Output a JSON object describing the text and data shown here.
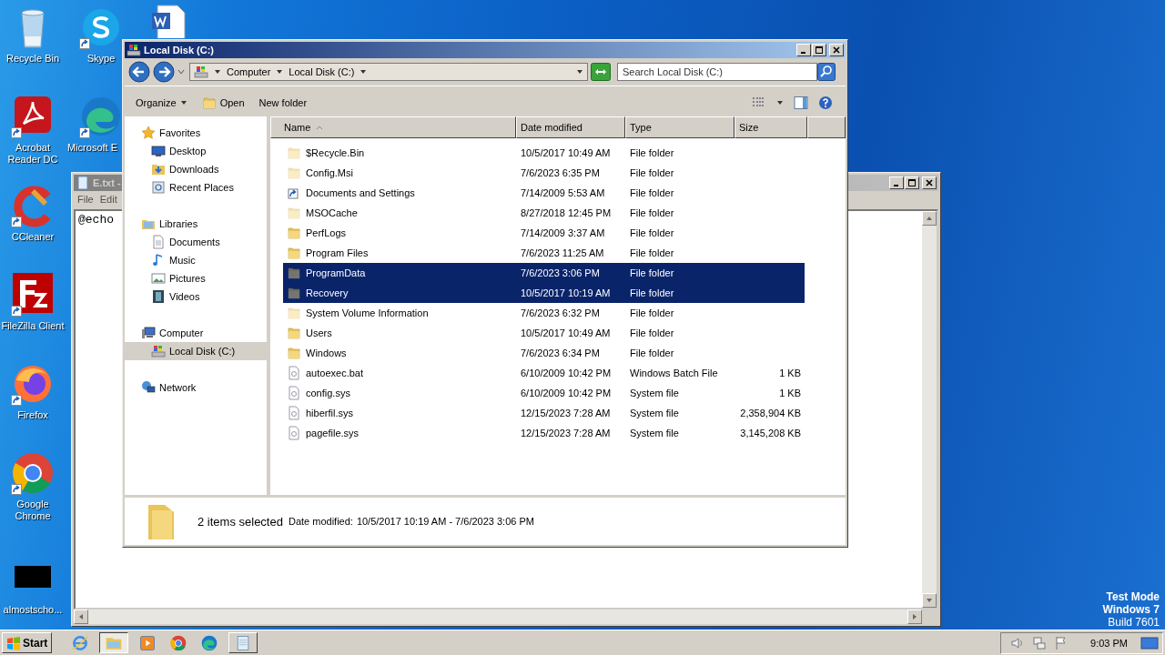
{
  "desktop_icons": [
    {
      "label": "Recycle Bin",
      "kind": "bin",
      "shortcut": false
    },
    {
      "label": "Acrobat Reader DC",
      "kind": "acrobat",
      "shortcut": true
    },
    {
      "label": "CCleaner",
      "kind": "ccleaner",
      "shortcut": true
    },
    {
      "label": "FileZilla Client",
      "kind": "filezilla",
      "shortcut": true
    },
    {
      "label": "Firefox",
      "kind": "firefox",
      "shortcut": true
    },
    {
      "label": "Google Chrome",
      "kind": "chrome",
      "shortcut": true
    },
    {
      "label": "almostscho...",
      "kind": "blank",
      "shortcut": false
    },
    {
      "label": "Skype",
      "kind": "skype",
      "shortcut": true
    },
    {
      "label": "Microsoft E",
      "kind": "edge",
      "shortcut": true
    },
    {
      "kind": "word",
      "shortcut": false
    }
  ],
  "notepad": {
    "title": "E.txt -",
    "menu": [
      "File",
      "Edit"
    ],
    "text": "@echo"
  },
  "explorer": {
    "title": "Local Disk (C:)",
    "breadcrumb": [
      "Computer",
      "Local Disk (C:)"
    ],
    "search": {
      "placeholder": "Search Local Disk (C:)"
    },
    "toolbar": [
      "Organize",
      "Open",
      "New folder"
    ],
    "nav": [
      {
        "label": "Favorites",
        "kind": "star",
        "selected": false,
        "children": [
          {
            "label": "Desktop",
            "kind": "desktop",
            "selected": false
          },
          {
            "label": "Downloads",
            "kind": "downloads",
            "selected": false
          },
          {
            "label": "Recent Places",
            "kind": "recent",
            "selected": false
          }
        ]
      },
      {
        "label": "Libraries",
        "kind": "libraries",
        "selected": false,
        "children": [
          {
            "label": "Documents",
            "kind": "documents",
            "selected": false
          },
          {
            "label": "Music",
            "kind": "music",
            "selected": false
          },
          {
            "label": "Pictures",
            "kind": "pictures",
            "selected": false
          },
          {
            "label": "Videos",
            "kind": "videos",
            "selected": false
          }
        ]
      },
      {
        "label": "Computer",
        "kind": "computer",
        "selected": false,
        "children": [
          {
            "label": "Local Disk (C:)",
            "kind": "disk",
            "selected": true
          }
        ]
      },
      {
        "label": "Network",
        "kind": "network",
        "selected": false
      }
    ],
    "columns": [
      "Name",
      "Date modified",
      "Type",
      "Size"
    ],
    "rows": [
      {
        "name": "$Recycle.Bin",
        "date": "10/5/2017 10:49 AM",
        "type": "File folder",
        "kind": "folder",
        "hidden": true,
        "selected": false
      },
      {
        "name": "Config.Msi",
        "date": "7/6/2023 6:35 PM",
        "type": "File folder",
        "kind": "folder",
        "hidden": true,
        "selected": false
      },
      {
        "name": "Documents and Settings",
        "date": "7/14/2009 5:53 AM",
        "type": "File folder",
        "kind": "shortcut",
        "hidden": false,
        "selected": false
      },
      {
        "name": "MSOCache",
        "date": "8/27/2018 12:45 PM",
        "type": "File folder",
        "kind": "folder",
        "hidden": true,
        "selected": false
      },
      {
        "name": "PerfLogs",
        "date": "7/14/2009 3:37 AM",
        "type": "File folder",
        "kind": "folder",
        "hidden": false,
        "selected": false
      },
      {
        "name": "Program Files",
        "date": "7/6/2023 11:25 AM",
        "type": "File folder",
        "kind": "folder",
        "hidden": false,
        "selected": false
      },
      {
        "name": "ProgramData",
        "date": "7/6/2023 3:06 PM",
        "type": "File folder",
        "kind": "folder",
        "hidden": true,
        "selected": true
      },
      {
        "name": "Recovery",
        "date": "10/5/2017 10:19 AM",
        "type": "File folder",
        "kind": "folder",
        "hidden": true,
        "selected": true
      },
      {
        "name": "System Volume Information",
        "date": "7/6/2023 6:32 PM",
        "type": "File folder",
        "kind": "folder",
        "hidden": true,
        "selected": false
      },
      {
        "name": "Users",
        "date": "10/5/2017 10:49 AM",
        "type": "File folder",
        "kind": "folder",
        "hidden": false,
        "selected": false
      },
      {
        "name": "Windows",
        "date": "7/6/2023 6:34 PM",
        "type": "File folder",
        "kind": "folder",
        "hidden": false,
        "selected": false
      },
      {
        "name": "autoexec.bat",
        "date": "6/10/2009 10:42 PM",
        "type": "Windows Batch File",
        "size": "1 KB",
        "kind": "file",
        "hidden": false,
        "selected": false
      },
      {
        "name": "config.sys",
        "date": "6/10/2009 10:42 PM",
        "type": "System file",
        "size": "1 KB",
        "kind": "file",
        "hidden": false,
        "selected": false
      },
      {
        "name": "hiberfil.sys",
        "date": "12/15/2023 7:28 AM",
        "type": "System file",
        "size": "2,358,904 KB",
        "kind": "file",
        "hidden": false,
        "selected": false
      },
      {
        "name": "pagefile.sys",
        "date": "12/15/2023 7:28 AM",
        "type": "System file",
        "size": "3,145,208 KB",
        "kind": "file",
        "hidden": false,
        "selected": false
      }
    ],
    "details": {
      "summary": "2 items selected",
      "label": "Date modified:",
      "value": "10/5/2017 10:19 AM - 7/6/2023 3:06 PM"
    }
  },
  "taskbar": {
    "start": "Start",
    "items": [
      {
        "kind": "ie",
        "running": false,
        "selected": false
      },
      {
        "kind": "explorer",
        "running": true,
        "selected": true
      },
      {
        "kind": "media",
        "running": false,
        "selected": false
      },
      {
        "kind": "chrome",
        "running": false,
        "selected": false
      },
      {
        "kind": "edge",
        "running": false,
        "selected": false
      },
      {
        "kind": "notepad",
        "running": true,
        "selected": false
      }
    ],
    "clock": "9:03 PM"
  },
  "test_mode": [
    "Test Mode",
    "Windows 7",
    "Build 7601"
  ]
}
